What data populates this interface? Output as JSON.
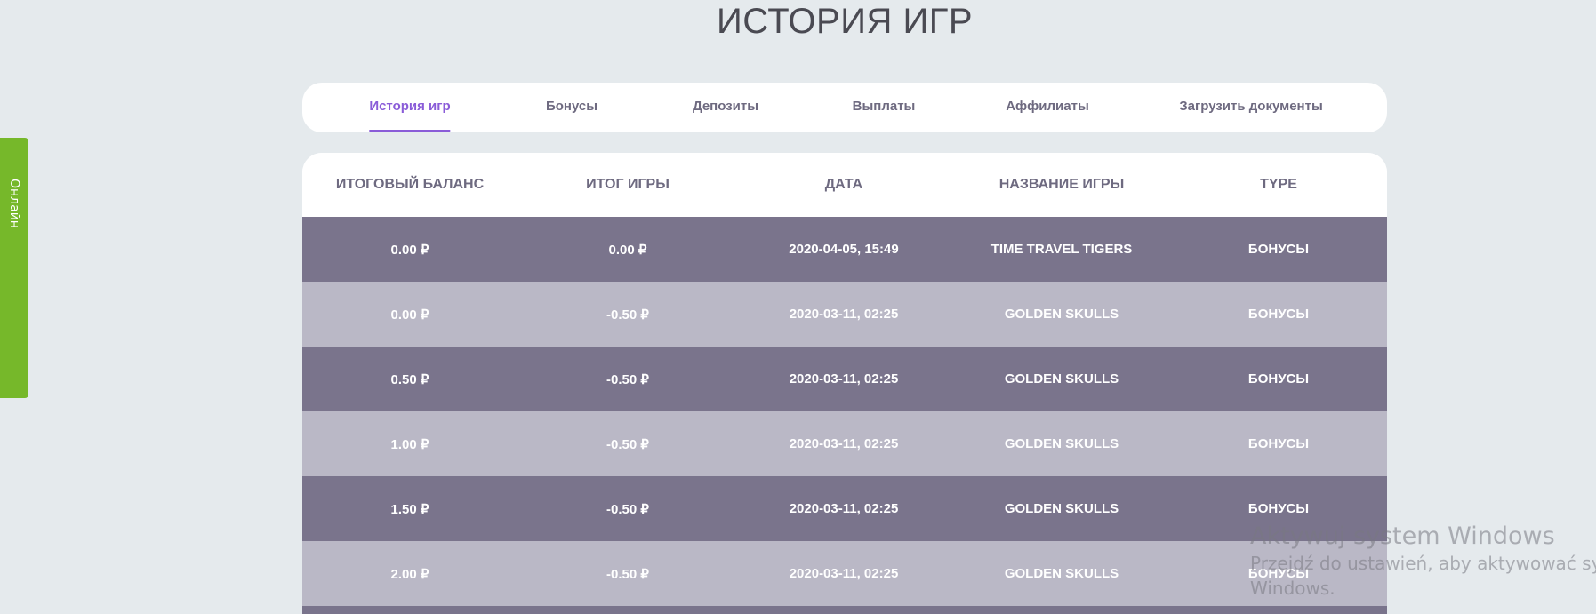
{
  "page_title": "ИСТОРИЯ ИГР",
  "side_tab": "Онлайн",
  "tabs": [
    {
      "label": "История игр",
      "active": true
    },
    {
      "label": "Бонусы"
    },
    {
      "label": "Депозиты"
    },
    {
      "label": "Выплаты"
    },
    {
      "label": "Аффилиаты"
    },
    {
      "label": "Загрузить документы"
    }
  ],
  "table": {
    "columns": [
      "ИТОГОВЫЙ БАЛАНС",
      "ИТОГ ИГРЫ",
      "ДАТА",
      "НАЗВАНИЕ ИГРЫ",
      "TYPE"
    ],
    "rows": [
      [
        "0.00 ₽",
        "0.00 ₽",
        "2020-04-05, 15:49",
        "TIME TRAVEL TIGERS",
        "БОНУСЫ"
      ],
      [
        "0.00 ₽",
        "-0.50 ₽",
        "2020-03-11, 02:25",
        "GOLDEN SKULLS",
        "БОНУСЫ"
      ],
      [
        "0.50 ₽",
        "-0.50 ₽",
        "2020-03-11, 02:25",
        "GOLDEN SKULLS",
        "БОНУСЫ"
      ],
      [
        "1.00 ₽",
        "-0.50 ₽",
        "2020-03-11, 02:25",
        "GOLDEN SKULLS",
        "БОНУСЫ"
      ],
      [
        "1.50 ₽",
        "-0.50 ₽",
        "2020-03-11, 02:25",
        "GOLDEN SKULLS",
        "БОНУСЫ"
      ],
      [
        "2.00 ₽",
        "-0.50 ₽",
        "2020-03-11, 02:25",
        "GOLDEN SKULLS",
        "БОНУСЫ"
      ]
    ]
  },
  "watermark": {
    "line1": "Aktywuj system Windows",
    "line2": "Przejdź do ustawień, aby aktywować system",
    "line3": "Windows."
  },
  "colors": {
    "accent": "#8a5cd8",
    "online": "#76b82a",
    "row_dark": "#7a748c",
    "row_light": "#bab8c6"
  }
}
